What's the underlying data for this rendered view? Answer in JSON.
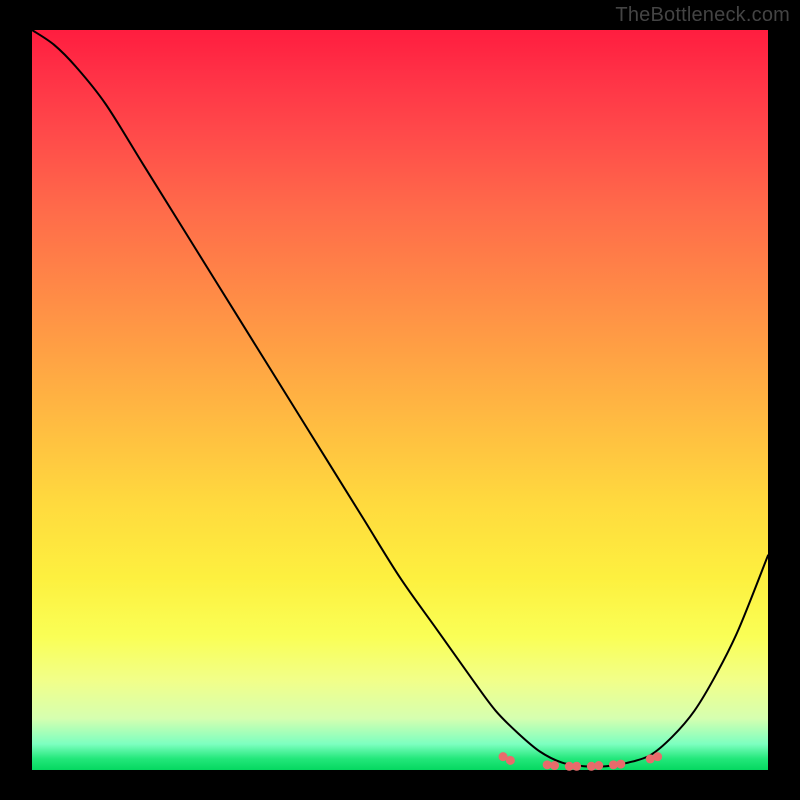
{
  "watermark": "TheBottleneck.com",
  "chart_data": {
    "type": "line",
    "title": "",
    "xlabel": "",
    "ylabel": "",
    "xlim": [
      0,
      100
    ],
    "ylim": [
      0,
      100
    ],
    "grid": false,
    "legend": false,
    "annotations": [],
    "series": [
      {
        "name": "curve",
        "x": [
          0,
          3,
          6,
          10,
          15,
          20,
          25,
          30,
          35,
          40,
          45,
          50,
          55,
          60,
          63,
          66,
          69,
          72,
          75,
          78,
          81,
          84,
          87,
          90,
          93,
          96,
          100
        ],
        "values": [
          100,
          98,
          95,
          90,
          82,
          74,
          66,
          58,
          50,
          42,
          34,
          26,
          19,
          12,
          8,
          5,
          2.5,
          1,
          0.5,
          0.5,
          1,
          2,
          4.5,
          8,
          13,
          19,
          29
        ]
      }
    ],
    "markers": {
      "name": "valley-dots",
      "color": "#e86b6b",
      "points": [
        {
          "x": 64,
          "y": 1.8
        },
        {
          "x": 65,
          "y": 1.3
        },
        {
          "x": 70,
          "y": 0.7
        },
        {
          "x": 71,
          "y": 0.6
        },
        {
          "x": 73,
          "y": 0.5
        },
        {
          "x": 74,
          "y": 0.5
        },
        {
          "x": 76,
          "y": 0.5
        },
        {
          "x": 77,
          "y": 0.6
        },
        {
          "x": 79,
          "y": 0.7
        },
        {
          "x": 80,
          "y": 0.8
        },
        {
          "x": 84,
          "y": 1.5
        },
        {
          "x": 85,
          "y": 1.8
        }
      ]
    },
    "gradient_bands": [
      {
        "pos": 0,
        "color": "#ff1d3f"
      },
      {
        "pos": 0.06,
        "color": "#ff3146"
      },
      {
        "pos": 0.14,
        "color": "#ff4a4a"
      },
      {
        "pos": 0.24,
        "color": "#ff6a4a"
      },
      {
        "pos": 0.34,
        "color": "#ff8647"
      },
      {
        "pos": 0.44,
        "color": "#ffa244"
      },
      {
        "pos": 0.54,
        "color": "#ffbe41"
      },
      {
        "pos": 0.64,
        "color": "#ffda3e"
      },
      {
        "pos": 0.74,
        "color": "#fdf03f"
      },
      {
        "pos": 0.82,
        "color": "#faff56"
      },
      {
        "pos": 0.88,
        "color": "#f1ff8a"
      },
      {
        "pos": 0.93,
        "color": "#d6ffb0"
      },
      {
        "pos": 0.965,
        "color": "#7cffc0"
      },
      {
        "pos": 0.985,
        "color": "#22e77a"
      },
      {
        "pos": 1.0,
        "color": "#05d860"
      }
    ]
  }
}
